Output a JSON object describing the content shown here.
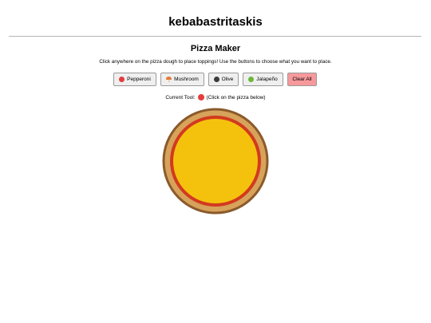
{
  "site": {
    "title": "kebabastritaskis"
  },
  "app": {
    "heading": "Pizza Maker",
    "instructions": "Click anywhere on the pizza dough to place toppings! Use the buttons to choose what you want to place."
  },
  "toolbar": {
    "buttons": [
      {
        "label": "Pepperoni",
        "icon": "pepperoni-icon",
        "color": "#e43d3d"
      },
      {
        "label": "Mushroom",
        "icon": "mushroom-icon",
        "color": "#e27a3a"
      },
      {
        "label": "Olive",
        "icon": "olive-icon",
        "color": "#3b3b3b"
      },
      {
        "label": "Jalapeño",
        "icon": "jalapeno-icon",
        "color": "#6cb83a"
      },
      {
        "label": "Clear All",
        "color": "#f7999c"
      }
    ]
  },
  "current_tool": {
    "prefix": "Current Tool:",
    "icon": "pepperoni-icon",
    "hint": "(Click on the pizza below)"
  },
  "pizza": {
    "crust_color": "#d7a25a",
    "crust_edge_color": "#8b5a2b",
    "sauce_color": "#d23a1f",
    "cheese_color": "#f4c20d"
  }
}
